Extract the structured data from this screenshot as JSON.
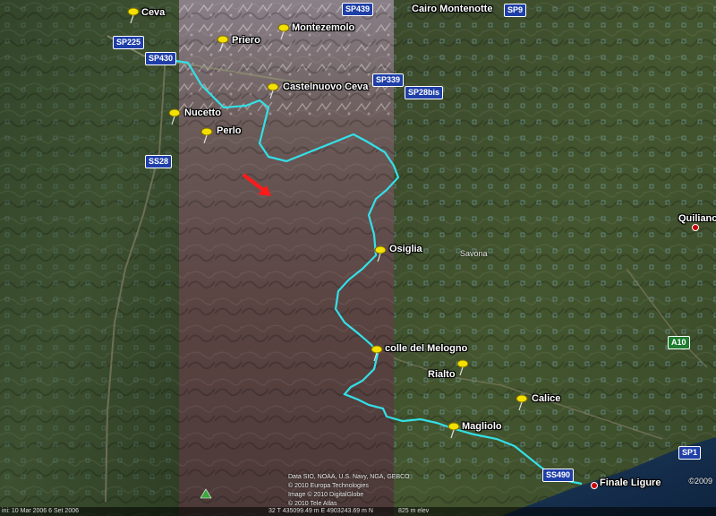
{
  "colors": {
    "track": "#33e0e8",
    "pin": "#f4e000",
    "arrow": "#ff1a1a",
    "road_shield": "#1f3fa8",
    "motorway_shield": "#1e7d2e"
  },
  "places": {
    "ceva": "Ceva",
    "priero": "Priero",
    "montezemolo": "Montezemolo",
    "cairo_montenotte": "Cairo Montenotte",
    "castelnuovo_ceva": "Castelnuovo Ceva",
    "nucetto": "Nucetto",
    "perlo": "Perlo",
    "osiglia": "Osiglia",
    "savona": "Savona",
    "quiliano": "Quiliano",
    "colle_del_melogno": "colle del Melogno",
    "rialto": "Rialto",
    "calice": "Calice",
    "magliolo": "Magliolo",
    "finale_ligure": "Finale Ligure"
  },
  "roads": {
    "sp439": "SP439",
    "sp9": "SP9",
    "sp225": "SP225",
    "sp430": "SP430",
    "sp339": "SP339",
    "sp28bis": "SP28bis",
    "ss28": "SS28",
    "a10": "A10",
    "sp1": "SP1",
    "ss490": "SS490"
  },
  "credits": {
    "line1": "Data SIO, NOAA, U.S. Navy, NGA, GEBCO",
    "line2": "© 2010 Europa Technologies",
    "line3": "Image © 2010 DigitalGlobe",
    "line4": "© 2010 Tele Atlas"
  },
  "copyright": "©2009",
  "status": {
    "imagery_date": "ini: 10 Mar 2006 6 Set 2006",
    "coords": "32 T 435099.49 m E 4903243.69 m N",
    "elevation": "825 m elev"
  }
}
